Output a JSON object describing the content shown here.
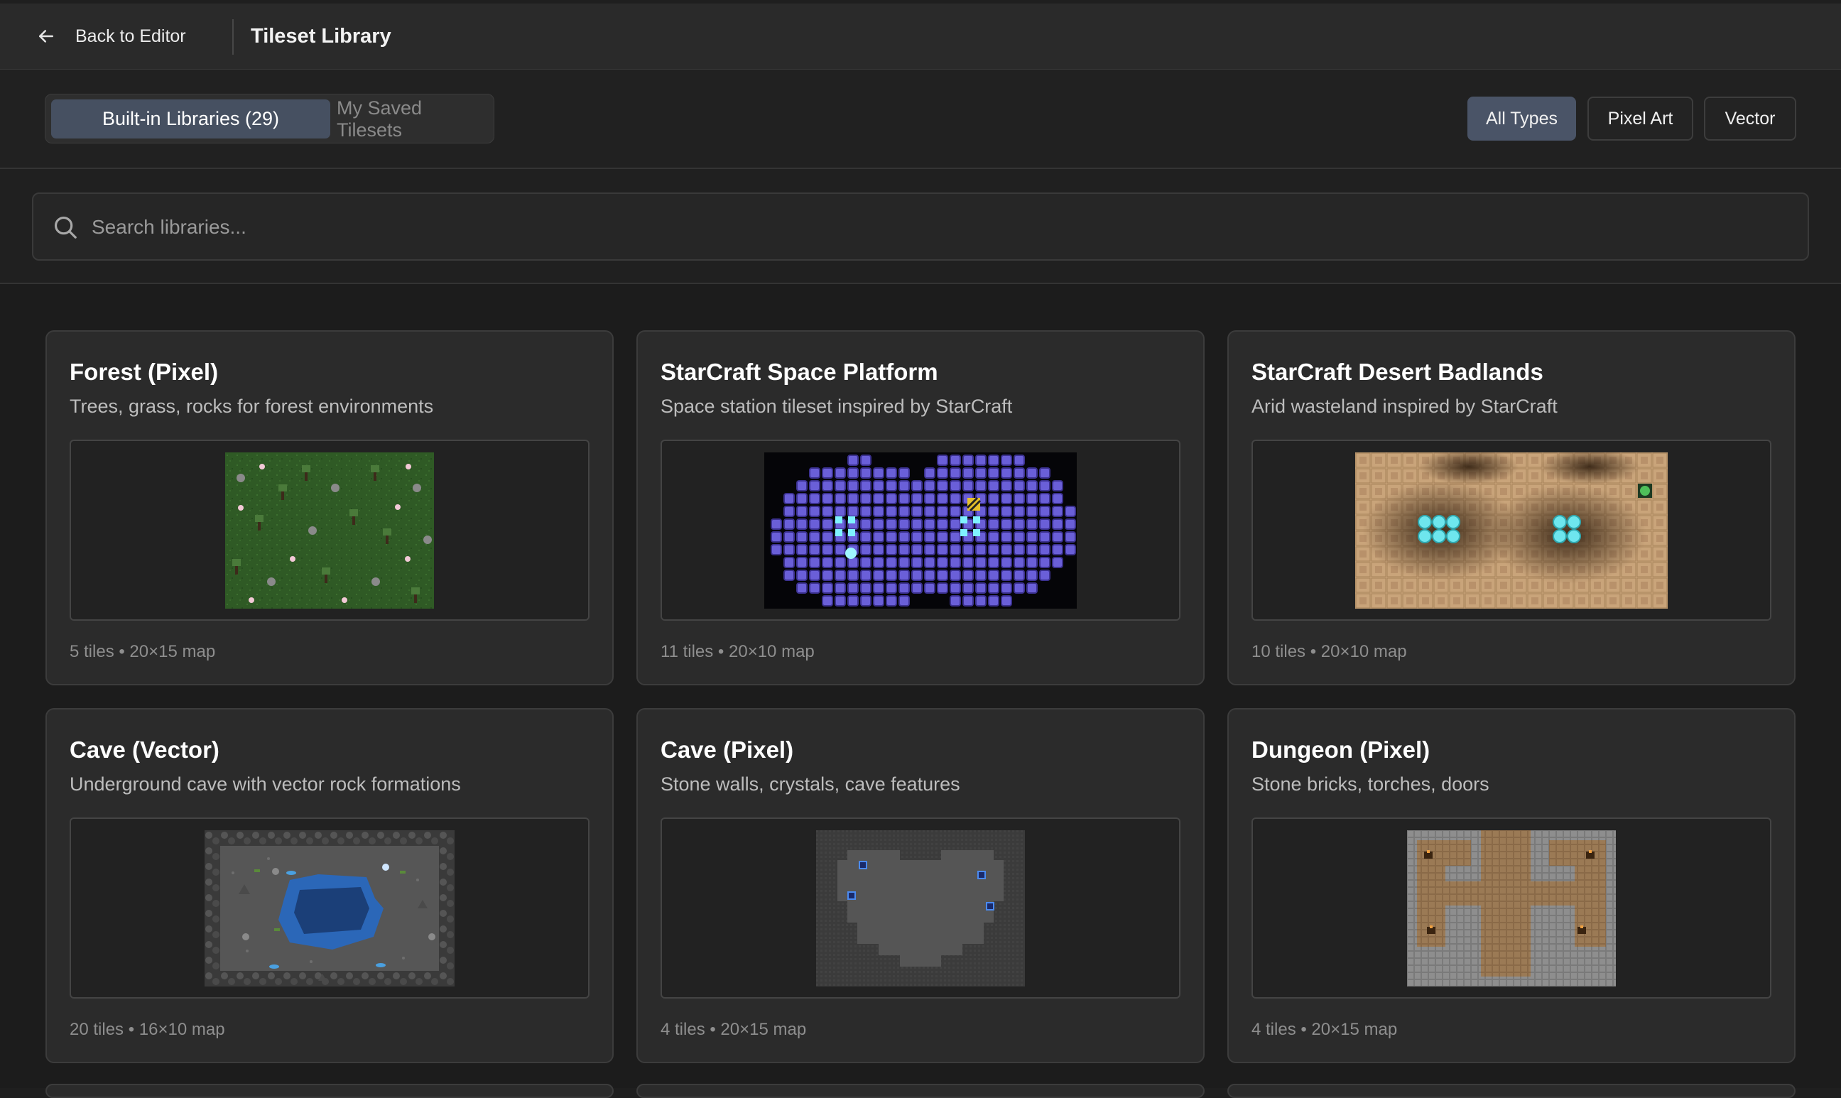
{
  "header": {
    "back_label": "Back to Editor",
    "title": "Tileset Library"
  },
  "tabs": {
    "builtin_label": "Built-in Libraries (29)",
    "saved_label": "My Saved Tilesets",
    "active": "builtin"
  },
  "filters": [
    {
      "label": "All Types",
      "active": true
    },
    {
      "label": "Pixel Art",
      "active": false
    },
    {
      "label": "Vector",
      "active": false
    }
  ],
  "search": {
    "placeholder": "Search libraries...",
    "value": ""
  },
  "libraries": [
    {
      "title": "Forest (Pixel)",
      "description": "Trees, grass, rocks for forest environments",
      "meta": "5 tiles • 20×15 map",
      "preview_style": "forest"
    },
    {
      "title": "StarCraft Space Platform",
      "description": "Space station tileset inspired by StarCraft",
      "meta": "11 tiles • 20×10 map",
      "preview_style": "space-platform"
    },
    {
      "title": "StarCraft Desert Badlands",
      "description": "Arid wasteland inspired by StarCraft",
      "meta": "10 tiles • 20×10 map",
      "preview_style": "desert"
    },
    {
      "title": "Cave (Vector)",
      "description": "Underground cave with vector rock formations",
      "meta": "20 tiles • 16×10 map",
      "preview_style": "cave-vector"
    },
    {
      "title": "Cave (Pixel)",
      "description": "Stone walls, crystals, cave features",
      "meta": "4 tiles • 20×15 map",
      "preview_style": "cave-pixel"
    },
    {
      "title": "Dungeon (Pixel)",
      "description": "Stone bricks, torches, doors",
      "meta": "4 tiles • 20×15 map",
      "preview_style": "dungeon"
    }
  ],
  "colors": {
    "accent": "#465061",
    "filter_active": "#4a5467",
    "card_bg": "#2b2b2b",
    "page_bg": "#1c1c1c"
  },
  "icons": {
    "back": "arrow-left-icon",
    "search": "search-icon"
  }
}
